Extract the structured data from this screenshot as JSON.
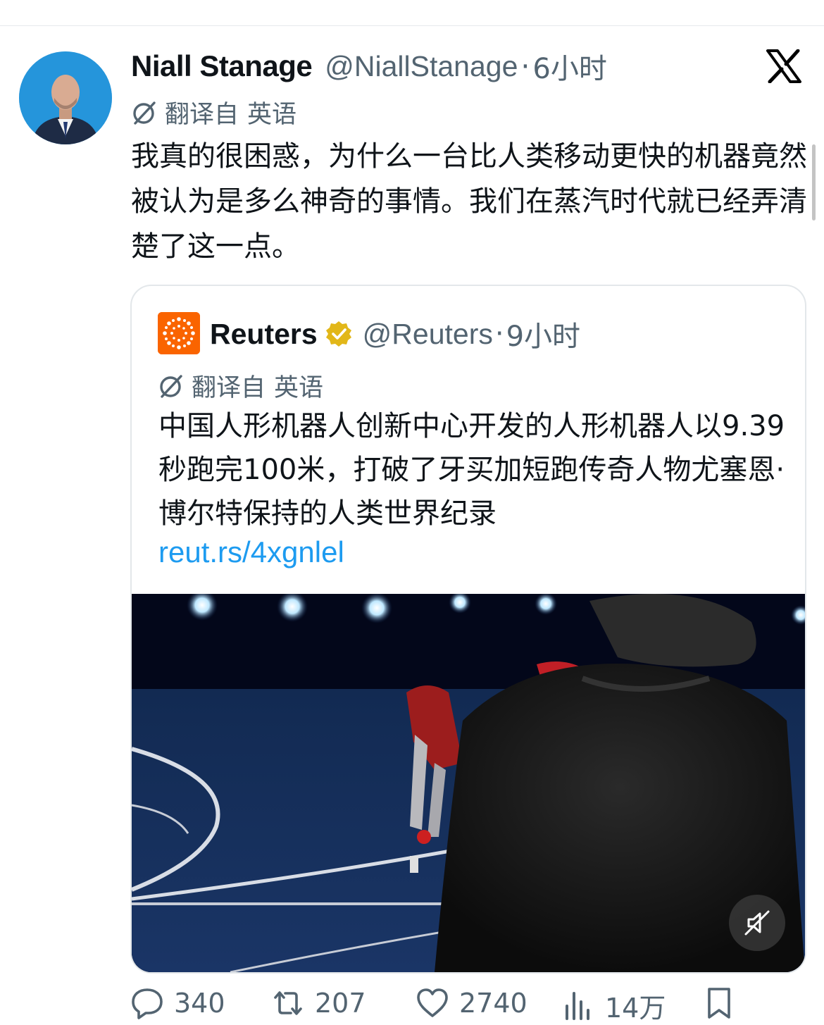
{
  "tweet": {
    "author": {
      "display_name": "Niall Stanage",
      "handle": "@NiallStanage",
      "time": "6小时"
    },
    "translation": {
      "label": "翻译自",
      "language": "英语"
    },
    "text": "我真的很困惑，为什么一台比人类移动更快的机器竟然被认为是多么神奇的事情。我们在蒸汽时代就已经弄清楚了这一点。"
  },
  "quote": {
    "author": {
      "display_name": "Reuters",
      "handle": "@Reuters",
      "time": "9小时"
    },
    "translation": {
      "label": "翻译自",
      "language": "英语"
    },
    "text": "中国人形机器人创新中心开发的人形机器人以9.39秒跑完100米，打破了牙买加短跑传奇人物尤塞恩·博尔特保持的人类世界纪录",
    "link": "reut.rs/4xgnlel"
  },
  "actions": {
    "replies": "340",
    "reposts": "207",
    "likes": "2740",
    "views": "14万"
  },
  "separator": "·",
  "icons": [
    "x-logo-icon",
    "translate-icon",
    "verified-badge-icon",
    "mute-icon",
    "reply-icon",
    "repost-icon",
    "like-icon",
    "views-icon",
    "bookmark-icon"
  ],
  "colors": {
    "link": "#1d9bf0",
    "muted": "#536471",
    "reuters": "#fa6400",
    "verified": "#e2b719"
  }
}
